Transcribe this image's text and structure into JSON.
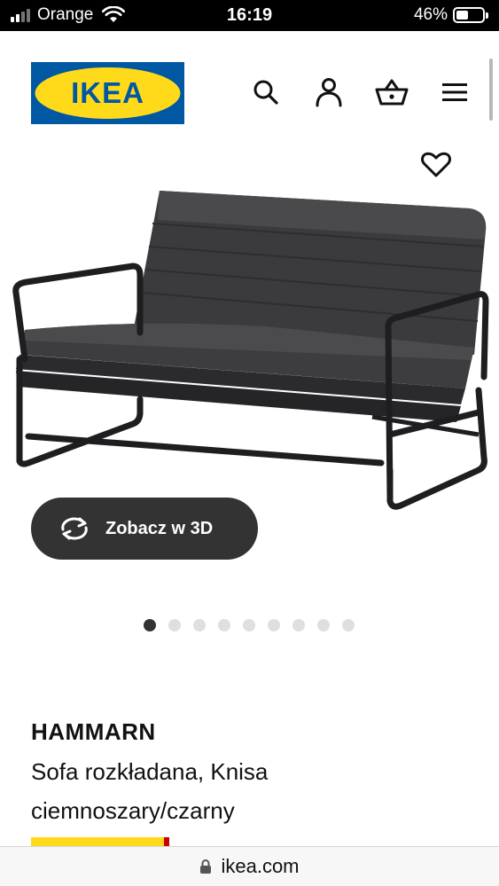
{
  "status_bar": {
    "carrier": "Orange",
    "time": "16:19",
    "battery_percent": "46%",
    "battery_level": 0.46,
    "signal_bars_active": 2,
    "signal_bars_total": 4
  },
  "header": {
    "logo_text": "IKEA",
    "icons": [
      "search-icon",
      "account-icon",
      "cart-icon",
      "menu-icon"
    ]
  },
  "gallery": {
    "wishlist_icon": "heart-icon",
    "view_3d_label": "Zobacz w 3D",
    "view_3d_icon": "rotate-icon",
    "dot_count": 9,
    "active_dot": 0
  },
  "product": {
    "name": "HAMMARN",
    "description": "Sofa rozkładana, Knisa ciemnoszary/czarny"
  },
  "browser": {
    "url": "ikea.com",
    "lock_icon": "lock-icon"
  },
  "colors": {
    "ikea_blue": "#0058a3",
    "ikea_yellow": "#ffda1a",
    "button_dark": "#333333",
    "dot_active": "#333333",
    "dot_inactive": "#dfdfdf"
  }
}
